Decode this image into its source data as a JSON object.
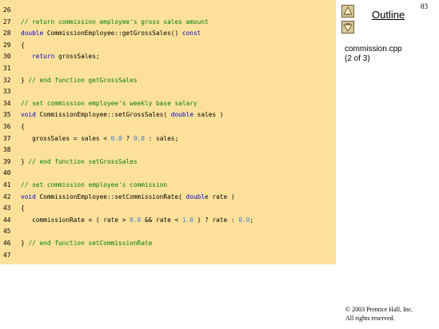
{
  "slide": {
    "page_number": "83",
    "outline_label": "Outline",
    "file_name": "commission.cpp",
    "page_info": "(2 of 3)",
    "copyright_line1": "© 2003 Prentice Hall, Inc.",
    "copyright_line2": "All rights reserved."
  },
  "nav": {
    "up_icon": "triangle-up-icon",
    "down_icon": "triangle-down-icon"
  },
  "colors": {
    "code_background": "#fde19b",
    "keyword": "#0000cc",
    "comment": "#008000",
    "number": "#3c78d8"
  },
  "code_lines": [
    {
      "num": "26",
      "segments": []
    },
    {
      "num": "27",
      "segments": [
        {
          "t": "// return commission employee's gross sales amount",
          "c": "cm"
        }
      ]
    },
    {
      "num": "28",
      "segments": [
        {
          "t": "double",
          "c": "kw"
        },
        {
          "t": " CommissionEmployee::getGrossSales() ",
          "c": ""
        },
        {
          "t": "const",
          "c": "kw"
        }
      ]
    },
    {
      "num": "29",
      "segments": [
        {
          "t": "{",
          "c": ""
        }
      ]
    },
    {
      "num": "30",
      "segments": [
        {
          "t": "   ",
          "c": ""
        },
        {
          "t": "return",
          "c": "kw"
        },
        {
          "t": " grossSales;",
          "c": ""
        }
      ]
    },
    {
      "num": "31",
      "segments": []
    },
    {
      "num": "32",
      "segments": [
        {
          "t": "} ",
          "c": ""
        },
        {
          "t": "// end function getGrossSales",
          "c": "cm"
        }
      ]
    },
    {
      "num": "33",
      "segments": []
    },
    {
      "num": "34",
      "segments": [
        {
          "t": "// set commission employee's weekly base salary",
          "c": "cm"
        }
      ]
    },
    {
      "num": "35",
      "segments": [
        {
          "t": "void",
          "c": "kw"
        },
        {
          "t": " CommissionEmployee::setGrossSales( ",
          "c": ""
        },
        {
          "t": "double",
          "c": "kw"
        },
        {
          "t": " sales )",
          "c": ""
        }
      ]
    },
    {
      "num": "36",
      "segments": [
        {
          "t": "{",
          "c": ""
        }
      ]
    },
    {
      "num": "37",
      "segments": [
        {
          "t": "   grossSales = sales < ",
          "c": ""
        },
        {
          "t": "0.0",
          "c": "num"
        },
        {
          "t": " ? ",
          "c": ""
        },
        {
          "t": "0.0",
          "c": "num"
        },
        {
          "t": " : sales;",
          "c": ""
        }
      ]
    },
    {
      "num": "38",
      "segments": []
    },
    {
      "num": "39",
      "segments": [
        {
          "t": "} ",
          "c": ""
        },
        {
          "t": "// end function setGrossSales",
          "c": "cm"
        }
      ]
    },
    {
      "num": "40",
      "segments": []
    },
    {
      "num": "41",
      "segments": [
        {
          "t": "// set commission employee's commission",
          "c": "cm"
        }
      ]
    },
    {
      "num": "42",
      "segments": [
        {
          "t": "void",
          "c": "kw"
        },
        {
          "t": " CommissionEmployee::setCommissionRate( ",
          "c": ""
        },
        {
          "t": "double",
          "c": "kw"
        },
        {
          "t": " rate )",
          "c": ""
        }
      ]
    },
    {
      "num": "43",
      "segments": [
        {
          "t": "{",
          "c": ""
        }
      ]
    },
    {
      "num": "44",
      "segments": [
        {
          "t": "   commissionRate = ( rate > ",
          "c": ""
        },
        {
          "t": "0.0",
          "c": "num"
        },
        {
          "t": " && rate < ",
          "c": ""
        },
        {
          "t": "1.0",
          "c": "num"
        },
        {
          "t": " ) ? rate : ",
          "c": ""
        },
        {
          "t": "0.0",
          "c": "num"
        },
        {
          "t": ";",
          "c": ""
        }
      ]
    },
    {
      "num": "45",
      "segments": []
    },
    {
      "num": "46",
      "segments": [
        {
          "t": "} ",
          "c": ""
        },
        {
          "t": "// end function setCommissionRate",
          "c": "cm"
        }
      ]
    },
    {
      "num": "47",
      "segments": []
    }
  ]
}
